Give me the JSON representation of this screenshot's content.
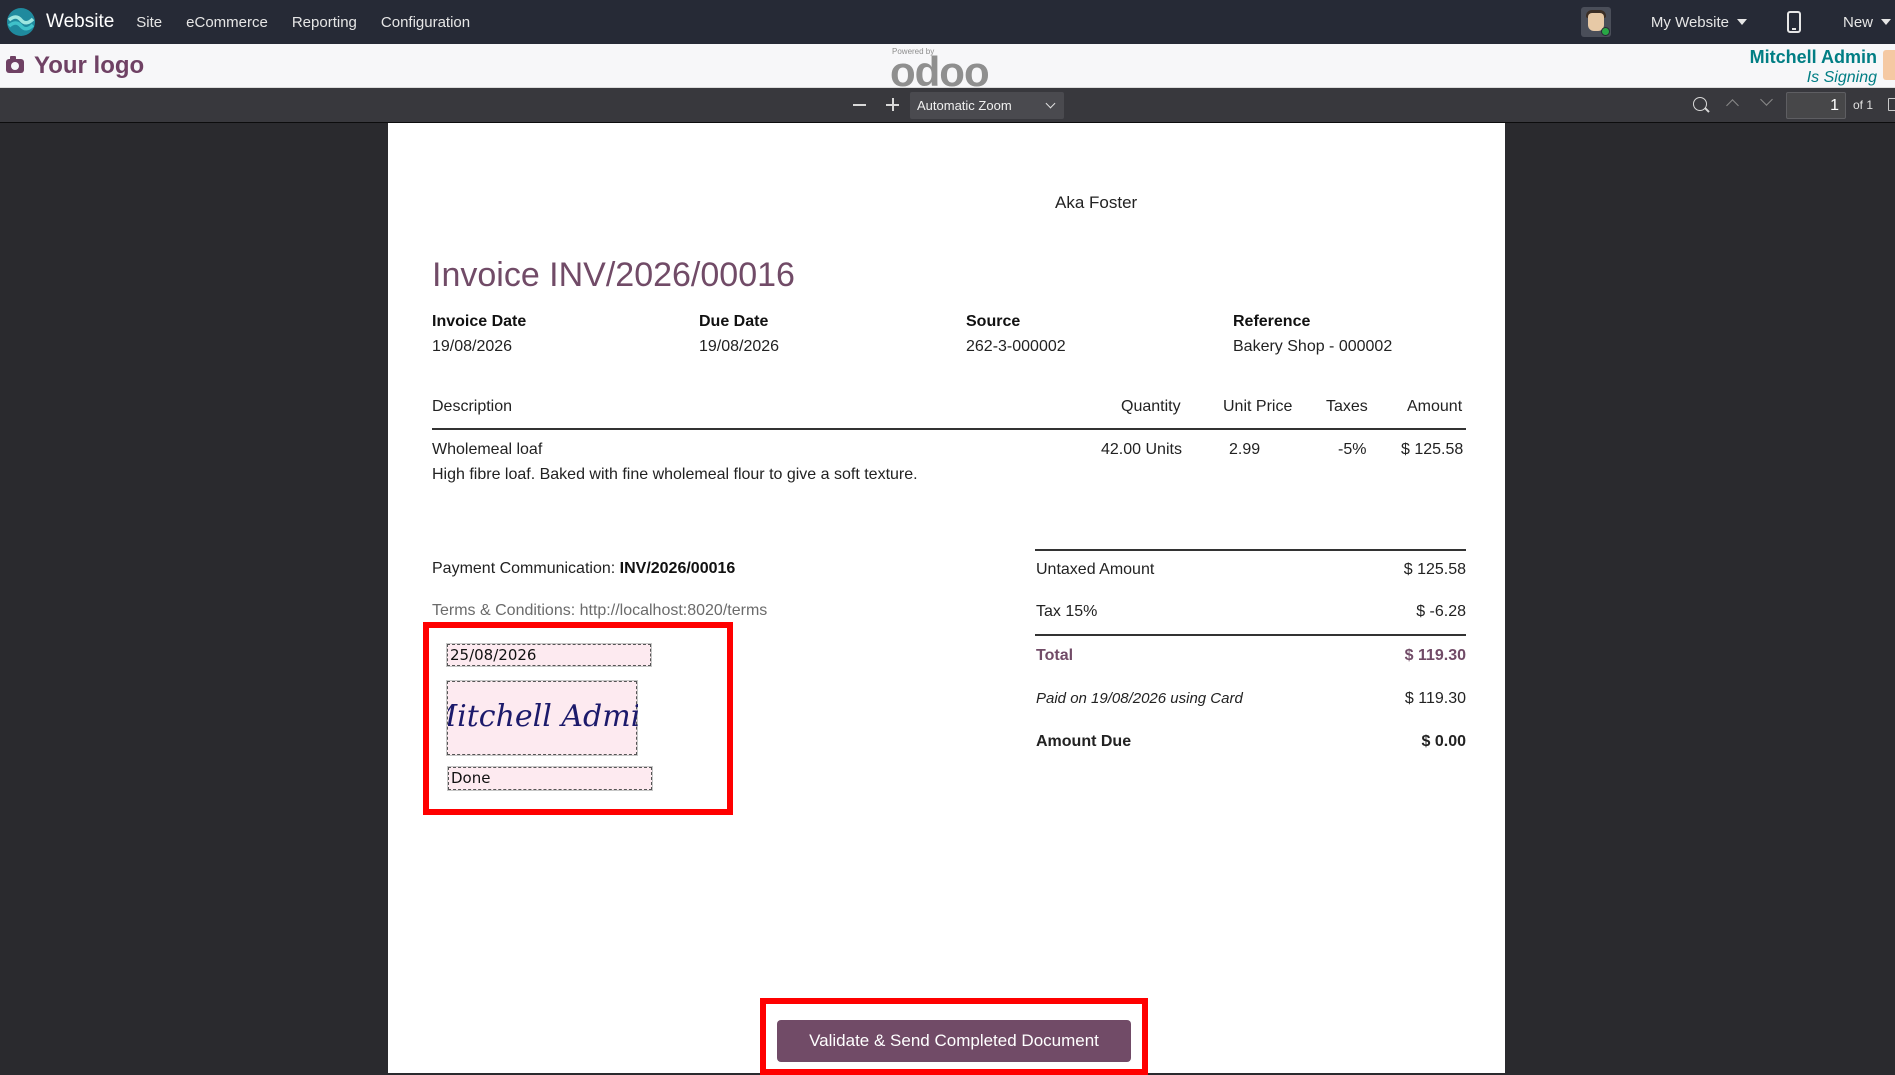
{
  "navbar": {
    "app_name": "Website",
    "menus": [
      "Site",
      "eCommerce",
      "Reporting",
      "Configuration"
    ],
    "website_selector": "My Website",
    "new_label": "New"
  },
  "sign_header": {
    "logo_text": "Your logo",
    "powered_by": "Powered by",
    "odoo_brand": "odoo",
    "signer_name": "Mitchell Admin",
    "signer_status": "Is Signing"
  },
  "pdf_toolbar": {
    "zoom_label": "Automatic Zoom",
    "page_number": "1",
    "page_count_label": "of 1"
  },
  "invoice": {
    "customer": "Aka Foster",
    "title": "Invoice INV/2026/00016",
    "meta": [
      {
        "label": "Invoice Date",
        "value": "19/08/2026"
      },
      {
        "label": "Due Date",
        "value": "19/08/2026"
      },
      {
        "label": "Source",
        "value": "262-3-000002"
      },
      {
        "label": "Reference",
        "value": "Bakery Shop - 000002"
      }
    ],
    "columns": {
      "description": "Description",
      "quantity": "Quantity",
      "unit_price": "Unit Price",
      "taxes": "Taxes",
      "amount": "Amount"
    },
    "lines": [
      {
        "name": "Wholemeal loaf",
        "detail": "High fibre loaf. Baked with fine wholemeal flour to give a soft texture.",
        "quantity": "42.00 Units",
        "unit_price": "2.99",
        "taxes": "-5%",
        "amount": "$ 125.58"
      }
    ],
    "payment_communication_label": "Payment Communication:",
    "payment_communication_value": "INV/2026/00016",
    "terms": "Terms & Conditions: http://localhost:8020/terms",
    "totals": {
      "untaxed_label": "Untaxed Amount",
      "untaxed_value": "$ 125.58",
      "tax_label": "Tax 15%",
      "tax_value": "$ -6.28",
      "total_label": "Total",
      "total_value": "$ 119.30",
      "paid_label": "Paid on 19/08/2026 using Card",
      "paid_value": "$ 119.30",
      "due_label": "Amount Due",
      "due_value": "$ 0.00"
    }
  },
  "sign_fields": {
    "date_value": "25/08/2026",
    "signature_name": "Mitchell Admin",
    "text_value": "Done"
  },
  "colors": {
    "brand": "#714b67",
    "teal": "#017e84",
    "highlight": "#ff0000"
  },
  "validate_button": "Validate & Send Completed Document"
}
